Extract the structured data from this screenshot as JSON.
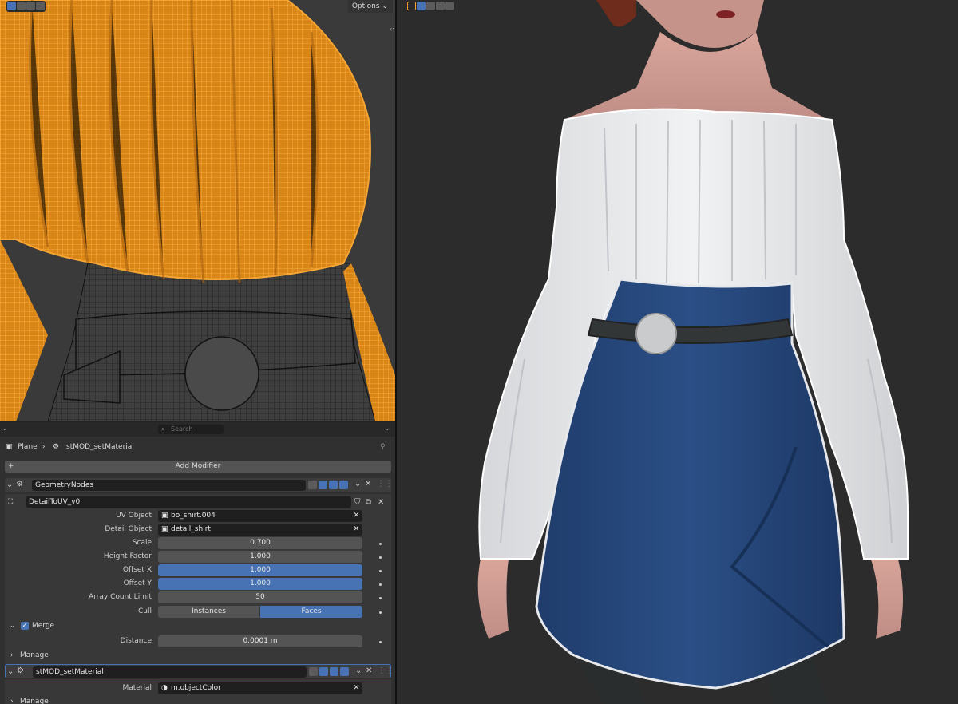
{
  "viewport_left": {
    "options_label": "Options"
  },
  "search": {
    "placeholder": "Search"
  },
  "breadcrumb": {
    "object": "Plane",
    "modifier": "stMOD_setMaterial"
  },
  "add_modifier_label": "Add Modifier",
  "modifier_geometry": {
    "name": "GeometryNodes",
    "node_group": "DetailToUV_v0",
    "props": {
      "uv_object_label": "UV Object",
      "uv_object_value": "bo_shirt.004",
      "detail_object_label": "Detail Object",
      "detail_object_value": "detail_shirt",
      "scale_label": "Scale",
      "scale_value": "0.700",
      "height_factor_label": "Height Factor",
      "height_factor_value": "1.000",
      "offset_x_label": "Offset X",
      "offset_x_value": "1.000",
      "offset_y_label": "Offset Y",
      "offset_y_value": "1.000",
      "array_count_label": "Array Count Limit",
      "array_count_value": "50",
      "cull_label": "Cull",
      "cull_option_instances": "Instances",
      "cull_option_faces": "Faces"
    },
    "merge": {
      "label": "Merge",
      "distance_label": "Distance",
      "distance_value": "0.0001 m"
    },
    "manage_label": "Manage"
  },
  "modifier_material": {
    "name": "stMOD_setMaterial",
    "material_label": "Material",
    "material_value": "m.objectColor",
    "manage_label": "Manage"
  },
  "colors": {
    "accent": "#4772b3",
    "wire": "#f29a1f",
    "skirt": "#24457a",
    "sweater": "#e9ebed"
  }
}
